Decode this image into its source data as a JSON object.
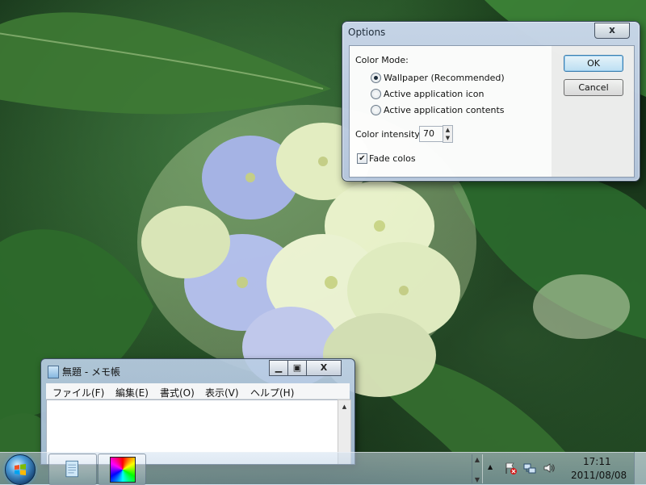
{
  "options_dialog": {
    "title": "Options",
    "close_label": "x",
    "color_mode_label": "Color Mode:",
    "radio_options": [
      "Wallpaper (Recommended)",
      "Active application icon",
      "Active application contents"
    ],
    "selected_radio": "Wallpaper (Recommended)",
    "intensity_label": "Color intensity:",
    "intensity_value": "70",
    "fade_label": "Fade colos",
    "fade_checked": true,
    "ok_label": "OK",
    "cancel_label": "Cancel"
  },
  "notepad": {
    "title": "無題 - メモ帳",
    "menu": [
      "ファイル(F)",
      "編集(E)",
      "書式(O)",
      "表示(V)",
      "ヘルプ(H)"
    ]
  },
  "taskbar": {
    "pinned": [
      "notepad-icon",
      "color-wheel-icon"
    ],
    "tray_icons": [
      "show-hidden-icons-arrow",
      "action-center-flag-icon",
      "network-icon",
      "volume-icon"
    ],
    "time": "17:11",
    "date": "2011/08/08"
  }
}
